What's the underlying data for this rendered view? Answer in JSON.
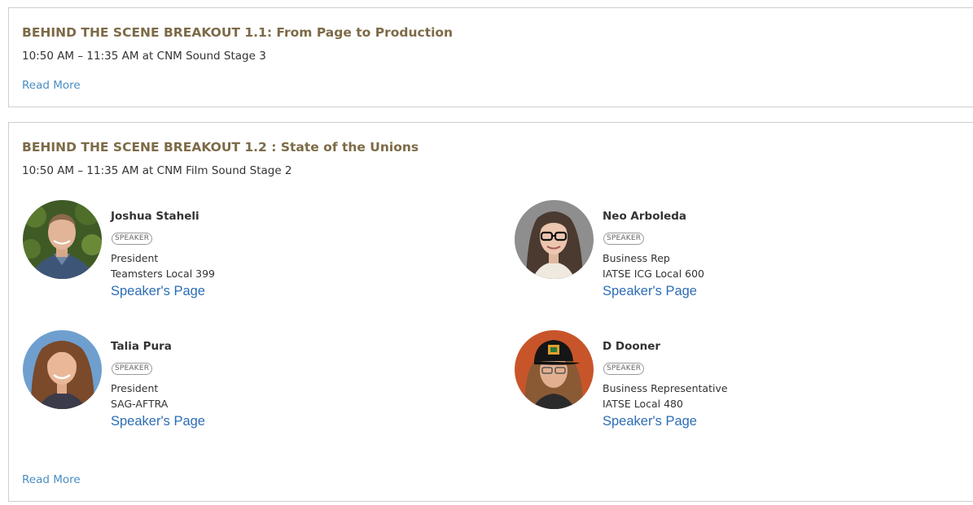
{
  "sessions": [
    {
      "title": "BEHIND THE SCENE BREAKOUT 1.1: From Page to Production",
      "time": "10:50 AM – 11:35 AM at CNM Sound Stage 3",
      "read_more": "Read More"
    },
    {
      "title": "BEHIND THE SCENE BREAKOUT 1.2 : State of the Unions",
      "time": "10:50 AM – 11:35 AM at CNM Film Sound Stage 2",
      "read_more": "Read More",
      "speakers": [
        {
          "name": "Joshua Staheli",
          "badge": "SPEAKER",
          "role": "President",
          "org": "Teamsters Local 399",
          "link": "Speaker's Page"
        },
        {
          "name": "Neo Arboleda",
          "badge": "SPEAKER",
          "role": "Business Rep",
          "org": "IATSE ICG Local 600",
          "link": "Speaker's Page"
        },
        {
          "name": "Talia Pura",
          "badge": "SPEAKER",
          "role": "President",
          "org": "SAG-AFTRA",
          "link": "Speaker's Page"
        },
        {
          "name": "D Dooner",
          "badge": "SPEAKER",
          "role": "Business Representative",
          "org": "IATSE Local 480",
          "link": "Speaker's Page"
        }
      ]
    }
  ],
  "colors": {
    "title": "#7d6a47",
    "read_more": "#4a8dc2",
    "speaker_link": "#2c6db5",
    "border": "#cfcfcf"
  }
}
